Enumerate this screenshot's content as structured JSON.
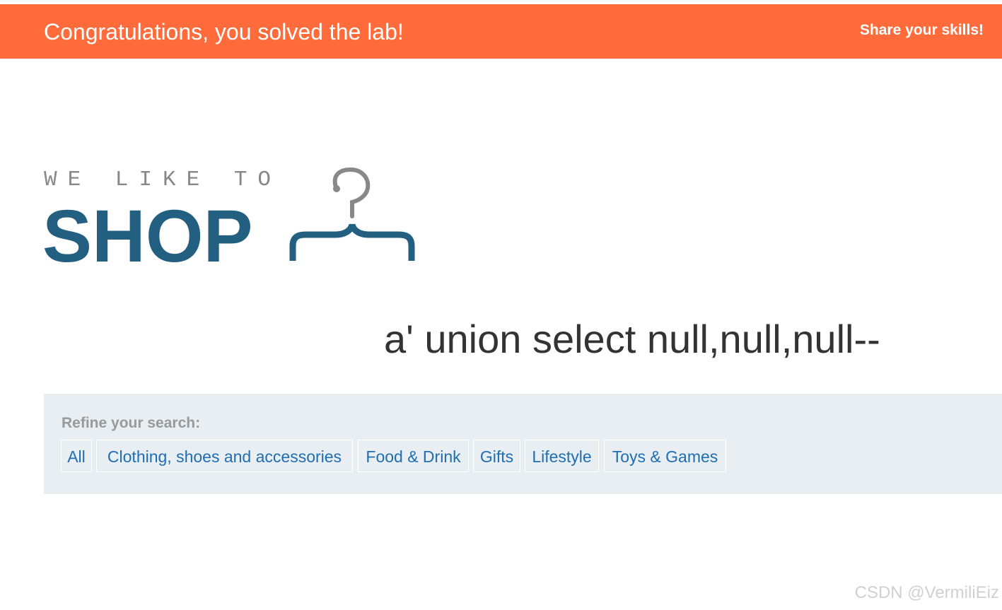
{
  "banner": {
    "title": "Congratulations, you solved the lab!",
    "share_label": "Share your skills!",
    "background": "#ff6b3a"
  },
  "logo": {
    "tagline": "WE LIKE TO",
    "name": "SHOP",
    "icon": "hanger-icon",
    "brand_color": "#225f80"
  },
  "search": {
    "term": "a' union select null,null,null--"
  },
  "filters": {
    "heading": "Refine your search:",
    "items": [
      {
        "label": "All"
      },
      {
        "label": "Clothing, shoes and accessories"
      },
      {
        "label": "Food & Drink"
      },
      {
        "label": "Gifts"
      },
      {
        "label": "Lifestyle"
      },
      {
        "label": "Toys & Games"
      }
    ],
    "link_color": "#1f6db3"
  },
  "watermark": {
    "text": "CSDN @VermiliEiz"
  }
}
